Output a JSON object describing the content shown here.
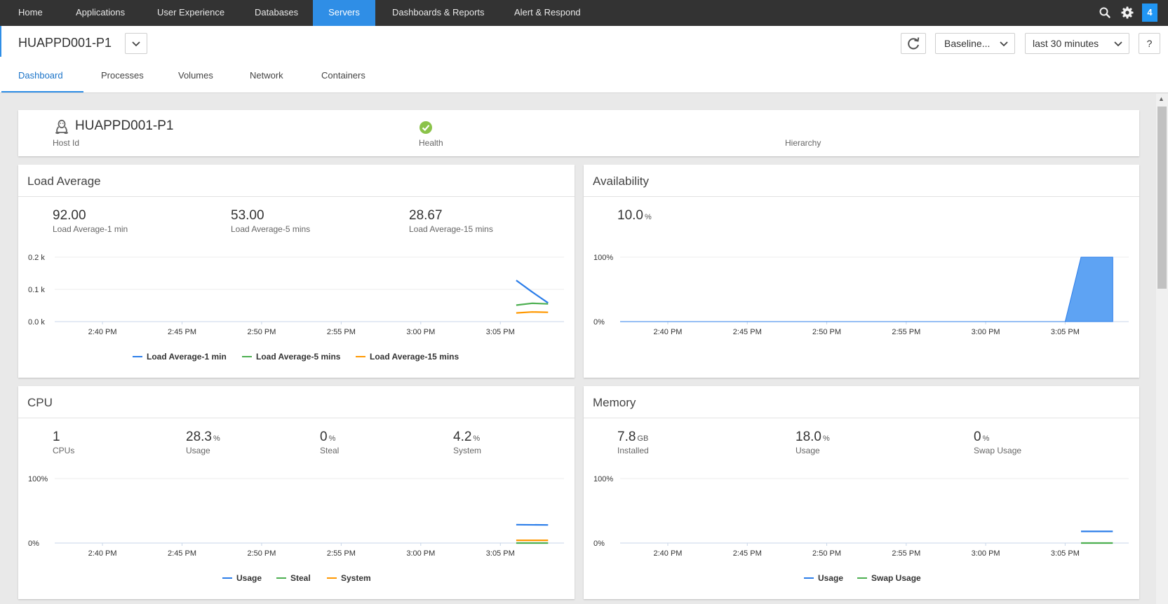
{
  "nav": {
    "items": [
      "Home",
      "Applications",
      "User Experience",
      "Databases",
      "Servers",
      "Dashboards & Reports",
      "Alert & Respond"
    ],
    "active": "Servers",
    "badge": "4",
    "icons": [
      "search-icon",
      "gear-icon"
    ]
  },
  "header": {
    "host": "HUAPPD001-P1",
    "baseline_label": "Baseline...",
    "time_range": "last 30 minutes",
    "help_label": "?",
    "tabs": [
      "Dashboard",
      "Processes",
      "Volumes",
      "Network",
      "Containers"
    ],
    "active_tab": "Dashboard"
  },
  "summary": {
    "host_name": "HUAPPD001-P1",
    "host_id_label": "Host Id",
    "health_label": "Health",
    "health_status": "healthy",
    "hierarchy_label": "Hierarchy"
  },
  "colors": {
    "accent": "#2f8ee6",
    "blue": "#2b7de9",
    "green": "#4caf50",
    "orange": "#ff9800",
    "health": "#8bc34a",
    "nav_bg": "#333333"
  },
  "time_ticks": [
    "2:40 PM",
    "2:45 PM",
    "2:50 PM",
    "2:55 PM",
    "3:00 PM",
    "3:05 PM"
  ],
  "load": {
    "title": "Load Average",
    "metrics": [
      {
        "value": "92.00",
        "label": "Load Average-1 min"
      },
      {
        "value": "53.00",
        "label": "Load Average-5 mins"
      },
      {
        "value": "28.67",
        "label": "Load Average-15 mins"
      }
    ],
    "y_ticks": [
      "0.2 k",
      "0.1 k",
      "0.0 k"
    ],
    "legend": [
      "Load Average-1 min",
      "Load Average-5 mins",
      "Load Average-15 mins"
    ]
  },
  "availability": {
    "title": "Availability",
    "value": "10.0",
    "unit": "%",
    "y_ticks": [
      "100%",
      "0%"
    ]
  },
  "cpu": {
    "title": "CPU",
    "metrics": [
      {
        "value": "1",
        "unit": "",
        "label": "CPUs"
      },
      {
        "value": "28.3",
        "unit": "%",
        "label": "Usage"
      },
      {
        "value": "0",
        "unit": "%",
        "label": "Steal"
      },
      {
        "value": "4.2",
        "unit": "%",
        "label": "System"
      }
    ],
    "y_ticks": [
      "100%",
      "0%"
    ],
    "legend": [
      "Usage",
      "Steal",
      "System"
    ]
  },
  "memory": {
    "title": "Memory",
    "metrics": [
      {
        "value": "7.8",
        "unit": "GB",
        "label": "Installed"
      },
      {
        "value": "18.0",
        "unit": "%",
        "label": "Usage"
      },
      {
        "value": "0",
        "unit": "%",
        "label": "Swap Usage"
      }
    ],
    "y_ticks": [
      "100%",
      "0%"
    ],
    "legend": [
      "Usage",
      "Swap Usage"
    ]
  },
  "chart_data": [
    {
      "type": "line",
      "title": "Load Average",
      "x_ticks": [
        "2:40 PM",
        "2:45 PM",
        "2:50 PM",
        "2:55 PM",
        "3:00 PM",
        "3:05 PM"
      ],
      "y_ticks": [
        "0.0 k",
        "0.1 k",
        "0.2 k"
      ],
      "ylim": [
        0,
        200
      ],
      "series": [
        {
          "name": "Load Average-1 min",
          "x": [
            "3:06 PM",
            "3:07 PM",
            "3:08 PM"
          ],
          "values": [
            128,
            92,
            58
          ]
        },
        {
          "name": "Load Average-5 mins",
          "x": [
            "3:06 PM",
            "3:07 PM",
            "3:08 PM"
          ],
          "values": [
            51,
            57,
            55
          ]
        },
        {
          "name": "Load Average-15 mins",
          "x": [
            "3:06 PM",
            "3:07 PM",
            "3:08 PM"
          ],
          "values": [
            27,
            30,
            29
          ]
        }
      ],
      "legend": "bottom",
      "grid": true
    },
    {
      "type": "area",
      "title": "Availability",
      "x_ticks": [
        "2:40 PM",
        "2:45 PM",
        "2:50 PM",
        "2:55 PM",
        "3:00 PM",
        "3:05 PM"
      ],
      "y_ticks": [
        "0%",
        "100%"
      ],
      "ylim": [
        0,
        100
      ],
      "series": [
        {
          "x": [
            "2:40 PM",
            "3:05 PM",
            "3:06 PM",
            "3:08 PM"
          ],
          "values": [
            0,
            0,
            100,
            100
          ]
        }
      ],
      "grid": true
    },
    {
      "type": "line",
      "title": "CPU",
      "x_ticks": [
        "2:40 PM",
        "2:45 PM",
        "2:50 PM",
        "2:55 PM",
        "3:00 PM",
        "3:05 PM"
      ],
      "y_ticks": [
        "0%",
        "100%"
      ],
      "ylim": [
        0,
        100
      ],
      "series": [
        {
          "name": "Usage",
          "x": [
            "3:06 PM",
            "3:08 PM"
          ],
          "values": [
            28.5,
            28
          ]
        },
        {
          "name": "Steal",
          "x": [
            "3:06 PM",
            "3:08 PM"
          ],
          "values": [
            0,
            0
          ]
        },
        {
          "name": "System",
          "x": [
            "3:06 PM",
            "3:08 PM"
          ],
          "values": [
            4.2,
            4.2
          ]
        }
      ],
      "legend": "bottom",
      "grid": true
    },
    {
      "type": "line",
      "title": "Memory",
      "x_ticks": [
        "2:40 PM",
        "2:45 PM",
        "2:50 PM",
        "2:55 PM",
        "3:00 PM",
        "3:05 PM"
      ],
      "y_ticks": [
        "0%",
        "100%"
      ],
      "ylim": [
        0,
        100
      ],
      "series": [
        {
          "name": "Usage",
          "x": [
            "3:06 PM",
            "3:08 PM"
          ],
          "values": [
            18,
            18
          ]
        },
        {
          "name": "Swap Usage",
          "x": [
            "3:06 PM",
            "3:08 PM"
          ],
          "values": [
            0,
            0
          ]
        }
      ],
      "legend": "bottom",
      "grid": true
    }
  ]
}
